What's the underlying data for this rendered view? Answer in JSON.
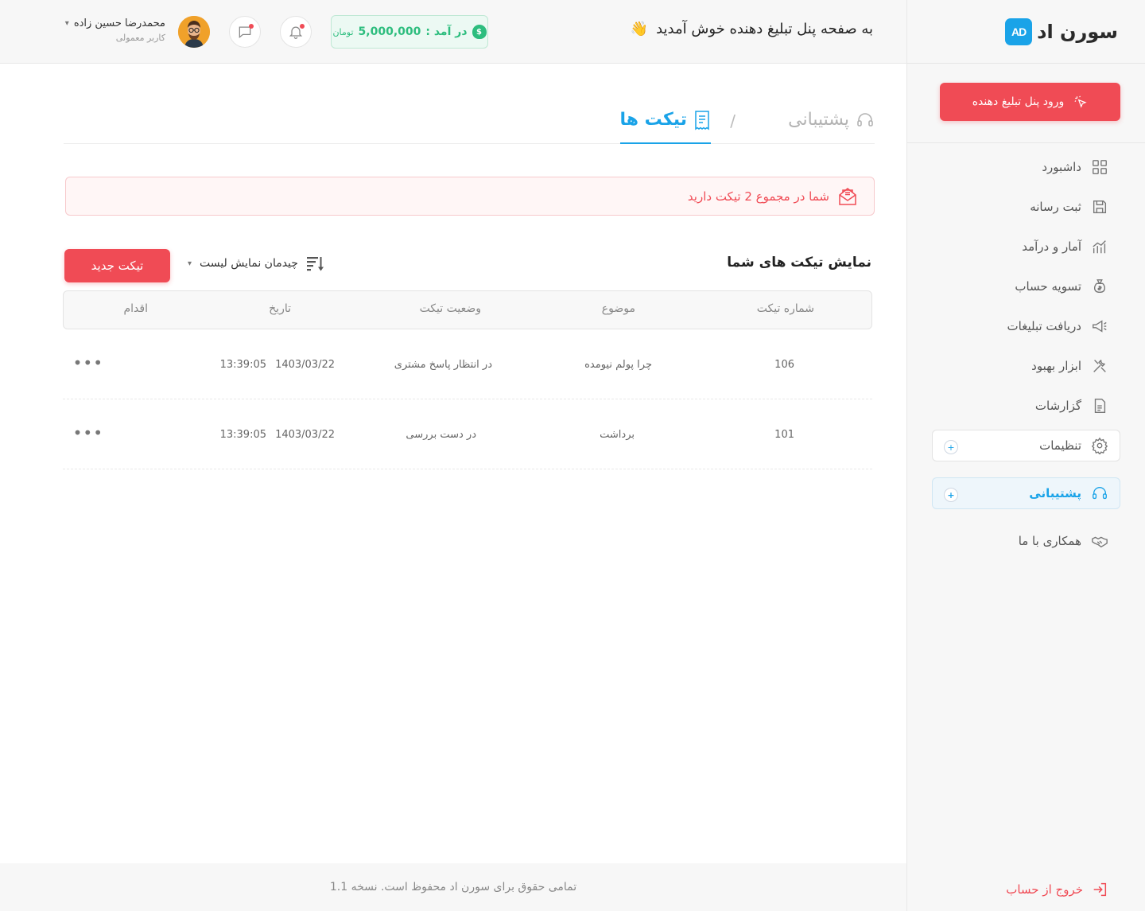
{
  "brand": {
    "logo_mark": "AD",
    "logo_text": "سورن اد"
  },
  "sidebar": {
    "login_button": "ورود پنل تبلیغ دهنده",
    "items": [
      {
        "label": "داشبورد",
        "icon": "grid-icon"
      },
      {
        "label": "ثبت رسانه",
        "icon": "save-icon"
      },
      {
        "label": "آمار و درآمد",
        "icon": "chart-icon"
      },
      {
        "label": "تسویه حساب",
        "icon": "money-bag-icon"
      },
      {
        "label": "دریافت تبلیغات",
        "icon": "megaphone-icon"
      },
      {
        "label": "ابزار بهبود",
        "icon": "tools-icon"
      },
      {
        "label": "گزارشات",
        "icon": "report-icon"
      },
      {
        "label": "تنظیمات",
        "icon": "gear-icon"
      },
      {
        "label": "پشتیبانی",
        "icon": "headset-icon"
      },
      {
        "label": "همکاری با ما",
        "icon": "handshake-icon"
      }
    ],
    "expand_symbol": "+",
    "logout": "خروج از حساب"
  },
  "header": {
    "welcome": "به صفحه پنل تبلیغ دهنده خوش آمدید",
    "wave": "👋",
    "income_label": "در آمد :",
    "income_value": "5,000,000",
    "income_unit": "تومان",
    "user_name": "محمدرضا حسین زاده",
    "user_role": "کاربر معمولی"
  },
  "breadcrumb": {
    "parent": "پشتیبانی",
    "separator": "/",
    "current": "تیکت ها"
  },
  "alert": {
    "text": "شما در مجموع 2 تیکت دارید"
  },
  "list": {
    "title": "نمایش تیکت های شما",
    "sort_label": "چیدمان نمایش لیست",
    "new_button": "تیکت جدید",
    "columns": [
      "شماره تیکت",
      "موضوع",
      "وضعیت تیکت",
      "تاریخ",
      "اقدام"
    ],
    "rows": [
      {
        "id": "106",
        "subject": "چرا پولم نیومده",
        "status": "در انتظار پاسخ مشتری",
        "date": "1403/03/22",
        "time": "13:39:05",
        "action": "•••"
      },
      {
        "id": "101",
        "subject": "برداشت",
        "status": "در دست بررسی",
        "date": "1403/03/22",
        "time": "13:39:05",
        "action": "•••"
      }
    ]
  },
  "footer": {
    "text": "تمامی حقوق برای سورن اد محفوظ است. نسخه 1.1"
  },
  "colors": {
    "accent": "#1aa3e8",
    "danger": "#f04b55",
    "success": "#2dbd7e"
  }
}
